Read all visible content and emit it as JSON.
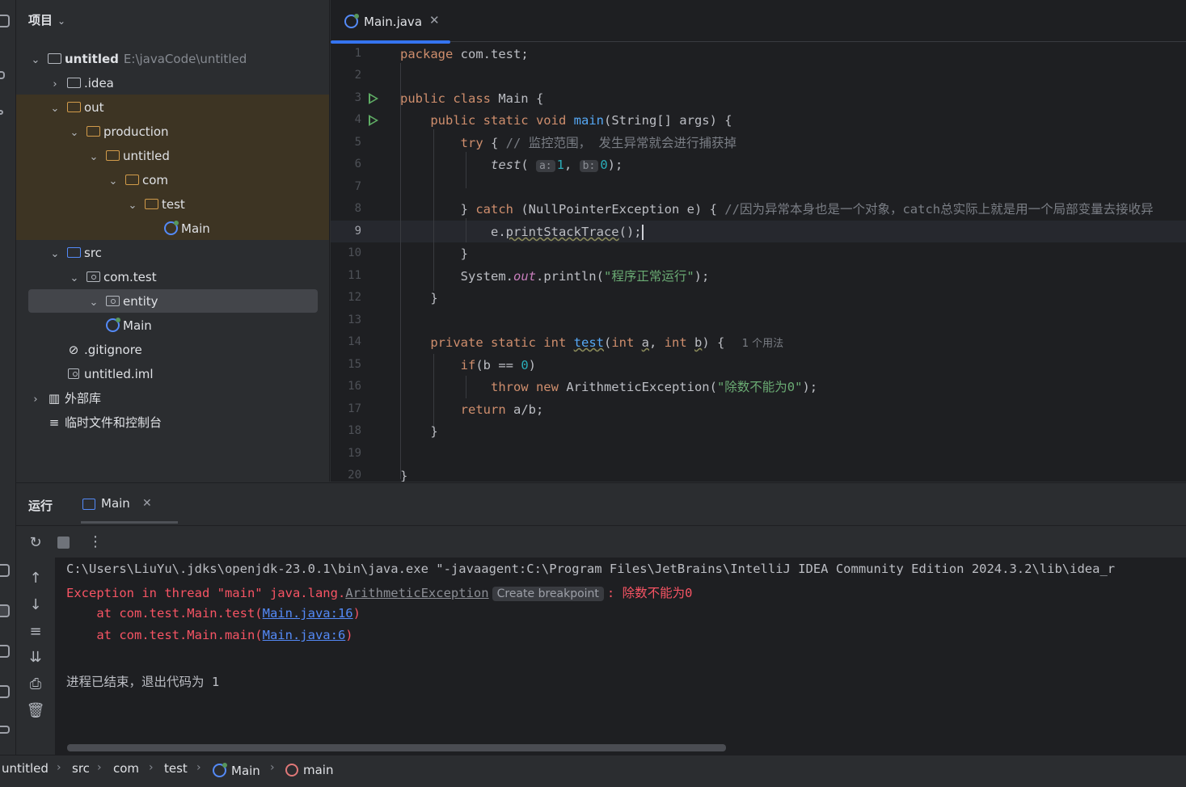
{
  "project": {
    "header": "项目",
    "tree": [
      {
        "label": "untitled",
        "path": "E:\\javaCode\\untitled"
      },
      {
        "label": ".idea"
      },
      {
        "label": "out"
      },
      {
        "label": "production"
      },
      {
        "label": "untitled"
      },
      {
        "label": "com"
      },
      {
        "label": "test"
      },
      {
        "label": "Main"
      },
      {
        "label": "src"
      },
      {
        "label": "com.test"
      },
      {
        "label": "entity"
      },
      {
        "label": "Main"
      },
      {
        "label": ".gitignore"
      },
      {
        "label": "untitled.iml"
      },
      {
        "label": "外部库"
      },
      {
        "label": "临时文件和控制台"
      }
    ]
  },
  "editor": {
    "tab_label": "Main.java",
    "line_numbers": [
      "1",
      "2",
      "3",
      "4",
      "5",
      "6",
      "7",
      "8",
      "9",
      "10",
      "11",
      "12",
      "13",
      "14",
      "15",
      "16",
      "17",
      "18",
      "19",
      "20"
    ],
    "comment_try": "// 监控范围， 发生异常就会进行捕获掉",
    "hint_a": "a:",
    "hint_b": "b:",
    "comment_catch": "//因为异常本身也是一个对象，catch总实际上就是用一个局部变量去接收异",
    "print_string": "\"程序正常运行\"",
    "usages": "1 个用法",
    "throw_string": "\"除数不能为0\""
  },
  "run": {
    "title": "运行",
    "tab_label": "Main",
    "cmd_line": "C:\\Users\\LiuYu\\.jdks\\openjdk-23.0.1\\bin\\java.exe \"-javaagent:C:\\Program Files\\JetBrains\\IntelliJ IDEA Community Edition 2024.3.2\\lib\\idea_r",
    "exc_prefix": "Exception in thread \"main\" java.lang.",
    "exc_class": "ArithmeticException",
    "create_bp": "Create breakpoint",
    "exc_msg": ": 除数不能为0",
    "at1_prefix": "    at com.test.Main.test(",
    "at1_link": "Main.java:16",
    "at2_prefix": "    at com.test.Main.main(",
    "at2_link": "Main.java:6",
    "close_paren": ")",
    "exit_msg": "进程已结束，退出代码为 1"
  },
  "breadcrumb": [
    "untitled",
    "src",
    "com",
    "test",
    "Main",
    "main"
  ],
  "colors": {
    "accent": "#3574f0",
    "keyword": "#cf8e6d",
    "function": "#56a8f5",
    "string": "#6aab73",
    "error": "#f75464"
  }
}
